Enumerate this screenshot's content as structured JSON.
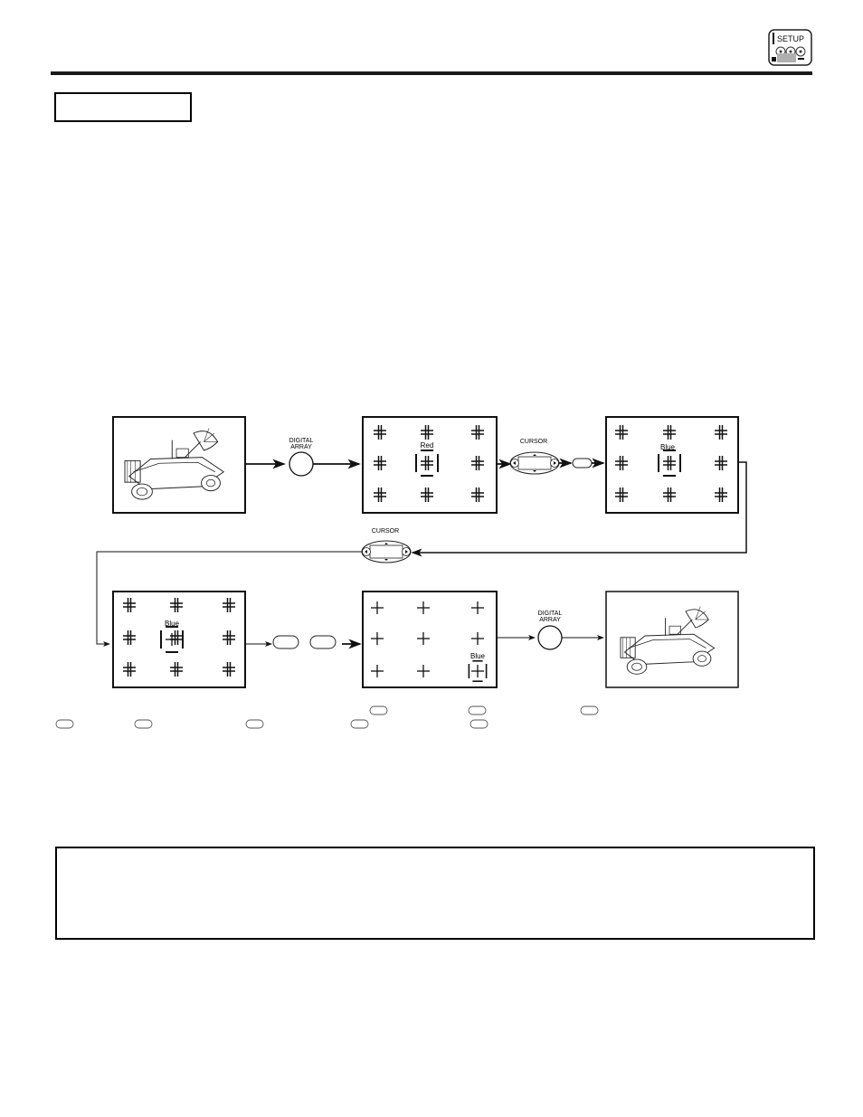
{
  "header": {
    "setup_icon_label": "SETUP"
  },
  "diagram": {
    "button_labels": {
      "digital_array_1": "DIGITAL ARRAY",
      "digital_array_2": "DIGITAL ARRAY",
      "cursor_1": "CURSOR",
      "cursor_2": "CURSOR"
    },
    "screens": {
      "grid_red": {
        "label": "Red"
      },
      "grid_blue_1": {
        "label": "Blue"
      },
      "grid_blue_2": {
        "label": "Blue"
      },
      "grid_final": {
        "label": "Blue"
      }
    },
    "digital_array_lines": [
      "DIGITAL",
      "ARRAY"
    ]
  }
}
